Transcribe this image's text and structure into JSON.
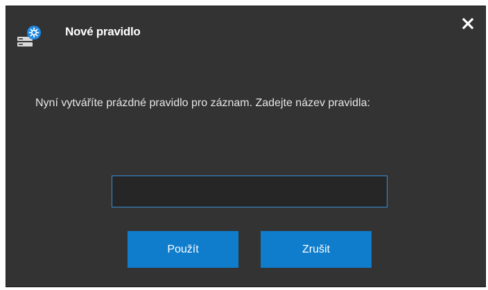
{
  "dialog": {
    "title": "Nové pravidlo",
    "title_icon": "server-gear-icon",
    "close_icon": "close-icon",
    "message": "Nyní vytváříte prázdné pravidlo pro záznam. Zadejte název pravidla:",
    "name_input": {
      "value": "",
      "placeholder": ""
    },
    "apply_label": "Použít",
    "cancel_label": "Zrušit"
  },
  "colors": {
    "background": "#333333",
    "accent": "#0f7ccc",
    "input_border": "#3a8fd6",
    "text": "#ffffff"
  }
}
